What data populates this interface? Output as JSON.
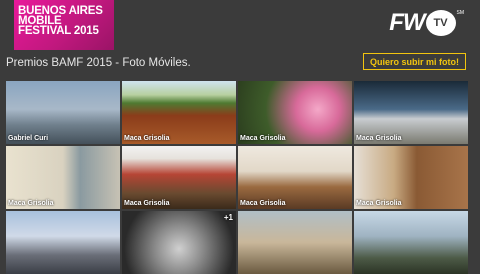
{
  "header": {
    "banner_lines": [
      "BUENOS AIRES",
      "MOBILE",
      "FESTIVAL 2015"
    ],
    "brand_letters": "FW",
    "brand_circle": "TV",
    "brand_mark": "SM"
  },
  "page": {
    "title": "Premios BAMF 2015 - Foto Móviles.",
    "upload_label": "Quiero subir mi foto!"
  },
  "gallery": [
    {
      "author": "Gabriel Curi",
      "badge": ""
    },
    {
      "author": "Maca Grisolia",
      "badge": ""
    },
    {
      "author": "Maca Grisolia",
      "badge": ""
    },
    {
      "author": "Maca Grisolia",
      "badge": ""
    },
    {
      "author": "Maca Grisolia",
      "badge": ""
    },
    {
      "author": "Maca Grisolia",
      "badge": ""
    },
    {
      "author": "Maca Grisolia",
      "badge": ""
    },
    {
      "author": "Maca Grisolia",
      "badge": ""
    },
    {
      "author": "",
      "badge": ""
    },
    {
      "author": "",
      "badge": "+1"
    },
    {
      "author": "",
      "badge": ""
    },
    {
      "author": "",
      "badge": ""
    }
  ],
  "colors": {
    "background": "#3b3b3b",
    "banner_pink": "#e8199a",
    "accent_yellow": "#f1c40f"
  }
}
